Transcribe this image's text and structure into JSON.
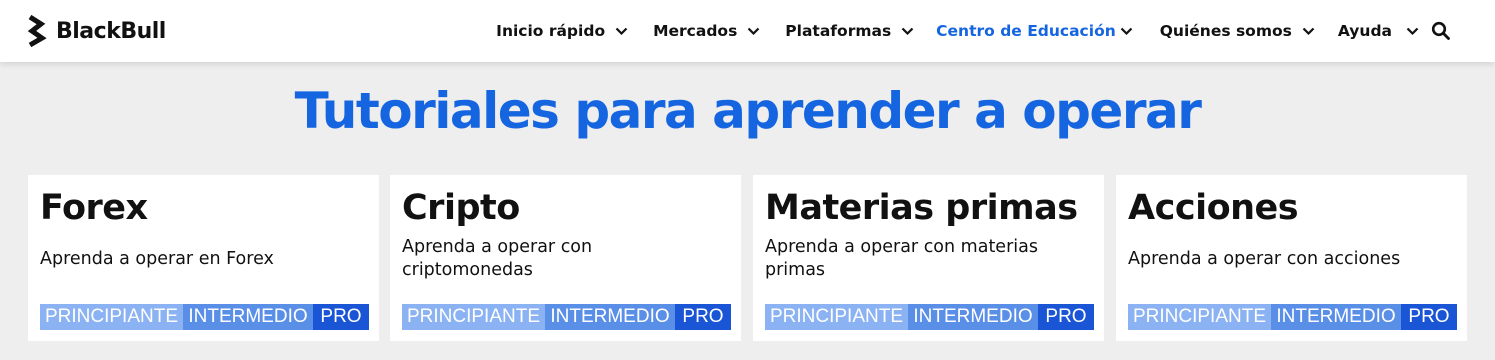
{
  "header": {
    "brand": "BlackBull",
    "nav": [
      {
        "label": "Inicio rápido",
        "active": false
      },
      {
        "label": "Mercados",
        "active": false
      },
      {
        "label": "Plataformas",
        "active": false
      },
      {
        "label": "Centro de Educación",
        "active": true
      },
      {
        "label": "Quiénes somos",
        "active": false
      },
      {
        "label": "Ayuda",
        "active": false
      }
    ],
    "search_icon": "search-icon"
  },
  "main": {
    "title": "Tutoriales para aprender a operar",
    "cards": [
      {
        "title": "Forex",
        "description": "Aprenda a operar en Forex",
        "levels": [
          "PRINCIPIANTE",
          "INTERMEDIO",
          "PRO"
        ]
      },
      {
        "title": "Cripto",
        "description": "Aprenda a operar con criptomonedas",
        "levels": [
          "PRINCIPIANTE",
          "INTERMEDIO",
          "PRO"
        ]
      },
      {
        "title": "Materias primas",
        "description": "Aprenda a operar con materias primas",
        "levels": [
          "PRINCIPIANTE",
          "INTERMEDIO",
          "PRO"
        ]
      },
      {
        "title": "Acciones",
        "description": "Aprenda a operar con acciones",
        "levels": [
          "PRINCIPIANTE",
          "INTERMEDIO",
          "PRO"
        ]
      }
    ]
  },
  "colors": {
    "accent": "#1565e0",
    "level_beginner": "#8bb2f2",
    "level_intermediate": "#5a8fe8",
    "level_pro": "#1a55d6",
    "background": "#eeeeee"
  }
}
